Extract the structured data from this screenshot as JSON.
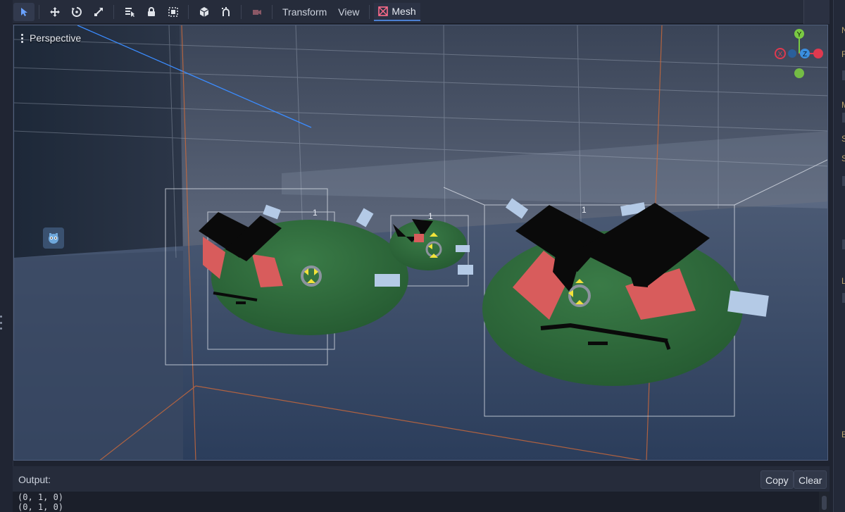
{
  "toolbar": {
    "tools": [
      {
        "icon": "select-arrow-icon",
        "active": true
      },
      {
        "icon": "move-icon"
      },
      {
        "icon": "rotate-icon"
      },
      {
        "icon": "scale-icon"
      },
      {
        "icon": "list-select-icon"
      },
      {
        "icon": "lock-icon"
      },
      {
        "icon": "group-icon"
      },
      {
        "icon": "local-space-icon"
      },
      {
        "icon": "snap-icon"
      },
      {
        "icon": "camera-preview-icon"
      }
    ],
    "menus": {
      "transform": "Transform",
      "view": "View",
      "mesh": "Mesh"
    }
  },
  "viewport": {
    "mode_label": "Perspective",
    "gizmo_axes": {
      "x": "X",
      "y": "Y",
      "z": "Z",
      "x_color": "#e0394f",
      "y_color": "#7ac943",
      "z_color": "#3a8fe0"
    },
    "overlay_labels": [
      "1",
      "1",
      "1"
    ],
    "colors": {
      "slime_green": "#2f6d3c",
      "eye_red": "#d85c5c",
      "brow_black": "#0a0a0a",
      "box_blue": "#aec6e6"
    }
  },
  "output": {
    "title": "Output:",
    "copy_label": "Copy",
    "clear_label": "Clear",
    "lines": [
      "(0, 1, 0)",
      "(0, 1, 0)"
    ]
  },
  "right_panel": {
    "letters": [
      "N",
      "F",
      "M",
      "S",
      "S",
      "L",
      "B"
    ]
  }
}
